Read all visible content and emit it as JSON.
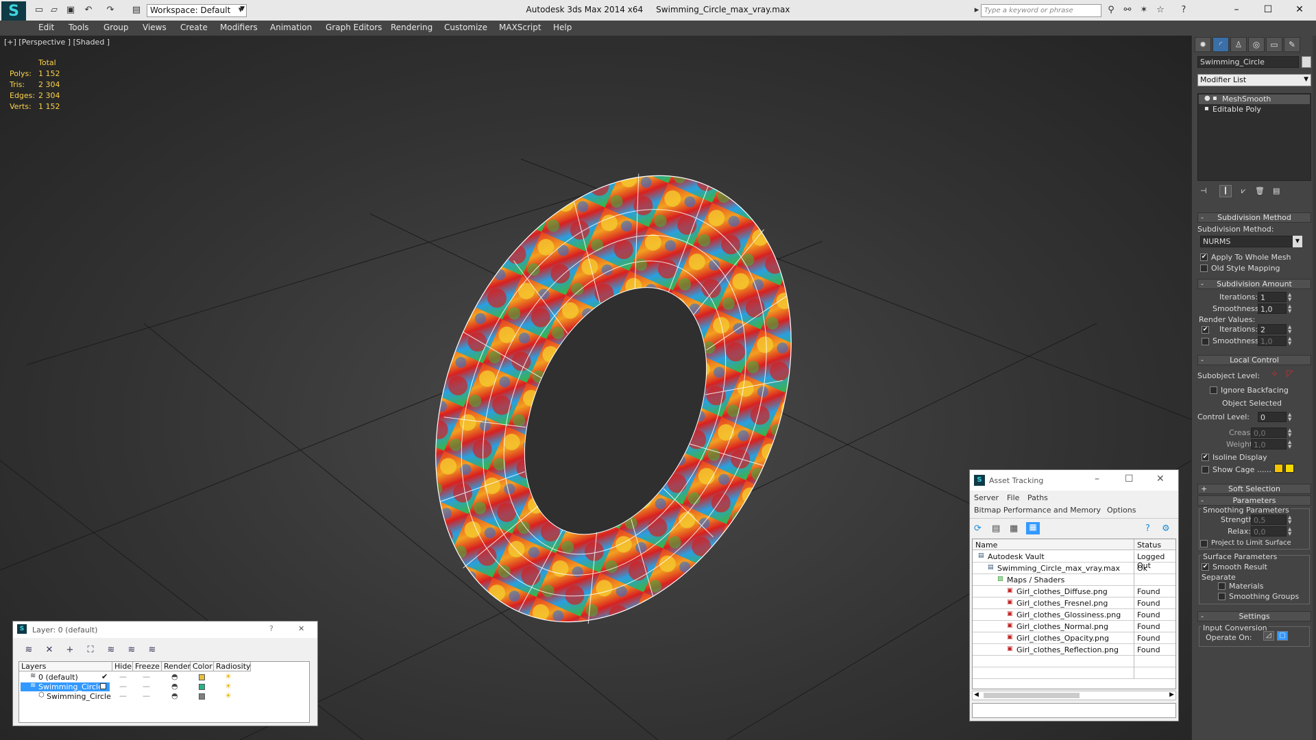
{
  "window": {
    "app_title": "Autodesk 3ds Max  2014 x64",
    "file_name": "Swimming_Circle_max_vray.max",
    "workspace": "Workspace: Default",
    "search_placeholder": "Type a keyword or phrase",
    "minimize": "–",
    "maximize": "☐",
    "close": "✕"
  },
  "menu": [
    "Edit",
    "Tools",
    "Group",
    "Views",
    "Create",
    "Modifiers",
    "Animation",
    "Graph Editors",
    "Rendering",
    "Customize",
    "MAXScript",
    "Help"
  ],
  "viewport": {
    "label": "[+] [Perspective ] [Shaded ]",
    "stats": {
      "header": "Total",
      "rows": [
        {
          "label": "Polys:",
          "value": "1 152"
        },
        {
          "label": "Tris:",
          "value": "2 304"
        },
        {
          "label": "Edges:",
          "value": "2 304"
        },
        {
          "label": "Verts:",
          "value": "1 152"
        }
      ]
    }
  },
  "command_panel": {
    "object_name": "Swimming_Circle",
    "modifier_list": "Modifier List",
    "stack": [
      "MeshSmooth",
      "Editable Poly"
    ],
    "subdivision_method": {
      "title": "Subdivision Method",
      "label": "Subdivision Method:",
      "value": "NURMS",
      "apply_whole_mesh": "Apply To Whole Mesh",
      "old_style_mapping": "Old Style Mapping"
    },
    "subdivision_amount": {
      "title": "Subdivision Amount",
      "iterations_label": "Iterations:",
      "iterations": "1",
      "smoothness_label": "Smoothness:",
      "smoothness": "1,0",
      "render_values": "Render Values:",
      "render_iterations_label": "Iterations:",
      "render_iterations": "2",
      "render_smoothness_label": "Smoothness:",
      "render_smoothness": "1,0"
    },
    "local_control": {
      "title": "Local Control",
      "subobject_level": "Subobject Level:",
      "ignore_backfacing": "Ignore Backfacing",
      "object_selected": "Object Selected",
      "control_level_label": "Control Level:",
      "control_level": "0",
      "crease_label": "Crease:",
      "crease": "0,0",
      "weight_label": "Weight:",
      "weight": "1,0",
      "isoline_display": "Isoline Display",
      "show_cage": "Show Cage ......"
    },
    "soft_selection": "Soft Selection",
    "parameters": {
      "title": "Parameters",
      "smoothing_parameters": "Smoothing Parameters",
      "strength_label": "Strength:",
      "strength": "0,5",
      "relax_label": "Relax:",
      "relax": "0,0",
      "project_limit": "Project to Limit Surface",
      "surface_parameters": "Surface Parameters",
      "smooth_result": "Smooth Result",
      "separate": "Separate",
      "materials": "Materials",
      "smoothing_groups": "Smoothing Groups"
    },
    "settings": {
      "title": "Settings",
      "input_conversion": "Input Conversion",
      "operate_on": "Operate On:"
    }
  },
  "asset_tracking": {
    "title": "Asset Tracking",
    "menus_row1": [
      "Server",
      "File",
      "Paths"
    ],
    "menus_row2": [
      "Bitmap Performance and Memory",
      "Options"
    ],
    "col_name": "Name",
    "col_status": "Status",
    "rows": [
      {
        "name": "Autodesk Vault",
        "status": "Logged Out",
        "indent": 0,
        "icon": "vault-icon"
      },
      {
        "name": "Swimming_Circle_max_vray.max",
        "status": "Ok",
        "indent": 1,
        "icon": "max-file-icon"
      },
      {
        "name": "Maps / Shaders",
        "status": "",
        "indent": 2,
        "icon": "maps-folder-icon"
      },
      {
        "name": "Girl_clothes_Diffuse.png",
        "status": "Found",
        "indent": 3,
        "icon": "png-icon"
      },
      {
        "name": "Girl_clothes_Fresnel.png",
        "status": "Found",
        "indent": 3,
        "icon": "png-icon"
      },
      {
        "name": "Girl_clothes_Glossiness.png",
        "status": "Found",
        "indent": 3,
        "icon": "png-icon"
      },
      {
        "name": "Girl_clothes_Normal.png",
        "status": "Found",
        "indent": 3,
        "icon": "png-icon"
      },
      {
        "name": "Girl_clothes_Opacity.png",
        "status": "Found",
        "indent": 3,
        "icon": "png-icon"
      },
      {
        "name": "Girl_clothes_Reflection.png",
        "status": "Found",
        "indent": 3,
        "icon": "png-icon"
      }
    ]
  },
  "layer_dialog": {
    "title": "Layer: 0 (default)",
    "help": "?",
    "close": "✕",
    "columns": [
      "Layers",
      "Hide",
      "Freeze",
      "Render",
      "Color",
      "Radiosity"
    ],
    "rows": [
      {
        "name": "0 (default)",
        "color": "#e8c040",
        "selected": false
      },
      {
        "name": "Swimming_Circle",
        "color": "#2ab088",
        "selected": true
      },
      {
        "name": "Swimming_Circle",
        "color": "#808080",
        "selected": false
      }
    ]
  },
  "colors": {
    "accent_blue": "#3399ff",
    "stats_yellow": "#ffd24a",
    "cage_yellow": "#f5c400"
  }
}
